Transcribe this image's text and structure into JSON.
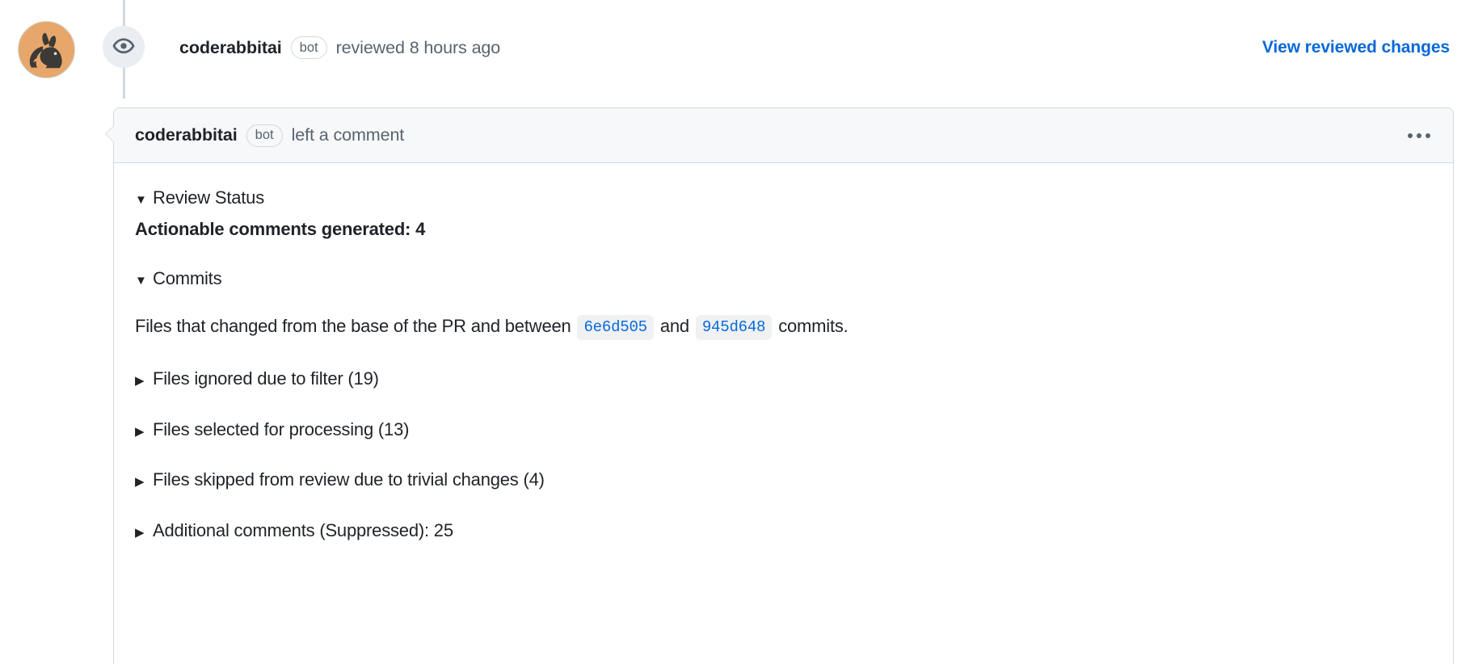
{
  "timeline_event": {
    "avatar_alt": "coderabbitai avatar",
    "avatar_bg_color": "#e8a76a",
    "badge_icon": "eye-icon",
    "actor": "coderabbitai",
    "bot_tag": "bot",
    "action_text": "reviewed 8 hours ago",
    "view_changes_label": "View reviewed changes",
    "link_color": "#0969da"
  },
  "comment": {
    "header": {
      "actor": "coderabbitai",
      "bot_tag": "bot",
      "action_text": "left a comment",
      "menu_icon": "kebab-menu-icon",
      "background_color": "#f6f8fa"
    },
    "body": {
      "review_status": {
        "marker": "▼",
        "label": "Review Status",
        "expanded": true,
        "actionable_comments": "Actionable comments generated: 4"
      },
      "commits": {
        "marker": "▼",
        "label": "Commits",
        "expanded": true,
        "description_prefix": "Files that changed from the base of the PR and between",
        "base_sha": "6e6d505",
        "conjunction": "and",
        "head_sha": "945d648",
        "description_suffix": "commits."
      },
      "collapsed_sections": [
        {
          "marker": "▶",
          "label": "Files ignored due to filter (19)"
        },
        {
          "marker": "▶",
          "label": "Files selected for processing (13)"
        },
        {
          "marker": "▶",
          "label": "Files skipped from review due to trivial changes (4)"
        },
        {
          "marker": "▶",
          "label": "Additional comments (Suppressed): 25"
        }
      ]
    }
  }
}
